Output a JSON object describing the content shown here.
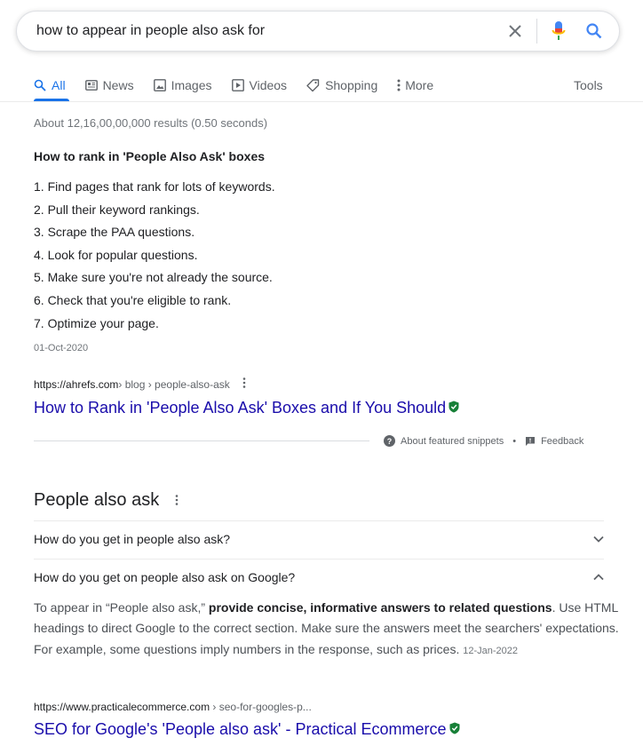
{
  "search": {
    "query": "how to appear in people also ask for"
  },
  "tabs": [
    {
      "label": "All",
      "icon": "search-icon"
    },
    {
      "label": "News",
      "icon": "news-icon"
    },
    {
      "label": "Images",
      "icon": "image-icon"
    },
    {
      "label": "Videos",
      "icon": "video-icon"
    },
    {
      "label": "Shopping",
      "icon": "tag-icon"
    },
    {
      "label": "More",
      "icon": "more-vert-icon"
    }
  ],
  "tools_label": "Tools",
  "result_stats": "About 12,16,00,00,000 results (0.50 seconds)",
  "featured_snippet": {
    "title": "How to rank in 'People Also Ask' boxes",
    "steps": [
      "1. Find pages that rank for lots of keywords.",
      "2. Pull their keyword rankings.",
      "3. Scrape the PAA questions.",
      "4. Look for popular questions.",
      "5. Make sure you're not already the source.",
      "6. Check that you're eligible to rank.",
      "7. Optimize your page."
    ],
    "date": "01-Oct-2020",
    "cite_domain": "https://ahrefs.com",
    "cite_path": " › blog › people-also-ask",
    "link_title": "How to Rank in 'People Also Ask' Boxes and If You Should",
    "about_label": "About featured snippets",
    "separator": "•",
    "feedback_label": "Feedback"
  },
  "people_also_ask": {
    "title": "People also ask",
    "questions": [
      {
        "text": "How do you get in people also ask?",
        "expanded": false
      },
      {
        "text": "How do you get on people also ask on Google?",
        "expanded": true
      }
    ],
    "answer": {
      "pre": "To appear in “People also ask,” ",
      "bold": "provide concise, informative answers to related questions",
      "post": ". Use HTML headings to direct Google to the correct section. Make sure the answers meet the searchers' expectations. For example, some questions imply numbers in the response, such as prices. ",
      "date": "12-Jan-2022"
    },
    "cite_domain": "https://www.practicalecommerce.com",
    "cite_path": " › seo-for-googles-p...",
    "link_title": "SEO for Google's 'People also ask' - Practical Ecommerce"
  },
  "colors": {
    "link": "#1a0dab",
    "accent": "#1a73e8",
    "verified": "#188038",
    "mic_red": "#ea4335"
  }
}
